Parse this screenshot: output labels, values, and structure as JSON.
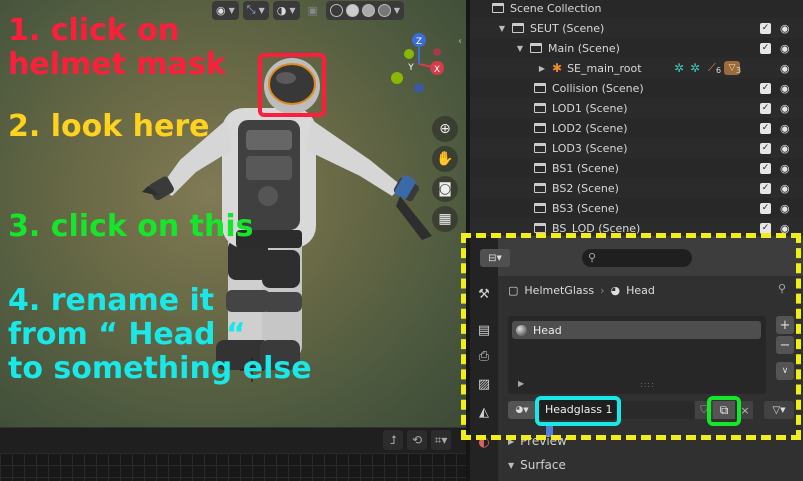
{
  "annotations": {
    "step1": "1. click on helmet mask",
    "step2": "2. look here",
    "step3": "3. click on this",
    "step4": "4. rename it from “ Head “ to something else",
    "step1_lines": [
      "1. click on",
      "helmet mask"
    ],
    "step4_lines": [
      "4. rename it",
      "from “ Head “",
      "to something else"
    ]
  },
  "gizmo": {
    "x_label": "X",
    "y_label": "Y",
    "z_label": "Z"
  },
  "outliner": {
    "title": "Scene Collection",
    "rows": [
      {
        "label": "SEUT (Scene)",
        "depth": 1,
        "expanded": true
      },
      {
        "label": "Main (Scene)",
        "depth": 2,
        "expanded": true
      },
      {
        "label": "SE_main_root",
        "depth": 3,
        "expanded": false,
        "badge_a": "6",
        "badge_b": "3"
      },
      {
        "label": "Collision (Scene)",
        "depth": 2
      },
      {
        "label": "LOD1 (Scene)",
        "depth": 2
      },
      {
        "label": "LOD2 (Scene)",
        "depth": 2
      },
      {
        "label": "LOD3 (Scene)",
        "depth": 2
      },
      {
        "label": "BS1 (Scene)",
        "depth": 2
      },
      {
        "label": "BS2 (Scene)",
        "depth": 2
      },
      {
        "label": "BS3 (Scene)",
        "depth": 2
      },
      {
        "label": "BS_LOD (Scene)",
        "depth": 2
      }
    ]
  },
  "properties": {
    "breadcrumb": {
      "object": "HelmetGlass",
      "material": "Head"
    },
    "slots": [
      "Head"
    ],
    "material_name_value": "Headglass 1",
    "panels": [
      "Preview",
      "Surface"
    ]
  }
}
